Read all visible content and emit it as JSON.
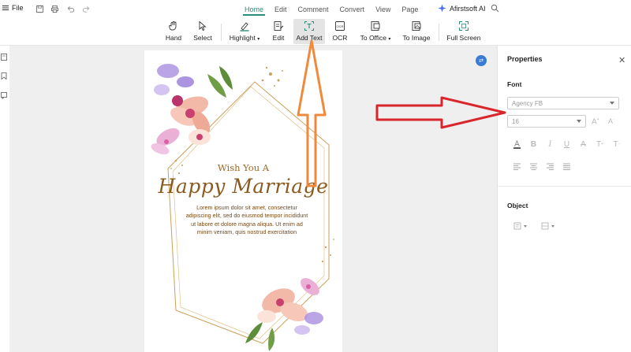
{
  "menubar": {
    "file_label": "File",
    "tabs": [
      {
        "label": "Home",
        "active": true
      },
      {
        "label": "Edit",
        "active": false
      },
      {
        "label": "Comment",
        "active": false
      },
      {
        "label": "Convert",
        "active": false
      },
      {
        "label": "View",
        "active": false
      },
      {
        "label": "Page",
        "active": false
      }
    ],
    "ai_label": "Afirstsoft AI"
  },
  "ribbon": {
    "hand": "Hand",
    "select": "Select",
    "highlight": "Highlight",
    "edit": "Edit",
    "add_text": "Add Text",
    "ocr": "OCR",
    "to_office": "To Office",
    "to_image": "To Image",
    "full_screen": "Full Screen",
    "active_tool": "Add Text"
  },
  "document": {
    "wish_line": "Wish You A",
    "headline": "Happy Marriage",
    "body_lines": [
      "Lorem ipsum dolor sit amet, consectetur",
      "adipiscing elit, sed do eiusmod tempor incididunt",
      "ut labore et dolore magna aliqua. Ut enim ad",
      "minim veniam, quis nostrud exercitation"
    ]
  },
  "properties": {
    "title": "Properties",
    "font_section": "Font",
    "font_family": "Agency FB",
    "font_size": "16",
    "object_section": "Object"
  },
  "colors": {
    "accent": "#2c8c7a",
    "annotation_red": "#d9262c",
    "annotation_orange": "#ef8a3c",
    "card_gold": "#9c6a25"
  }
}
